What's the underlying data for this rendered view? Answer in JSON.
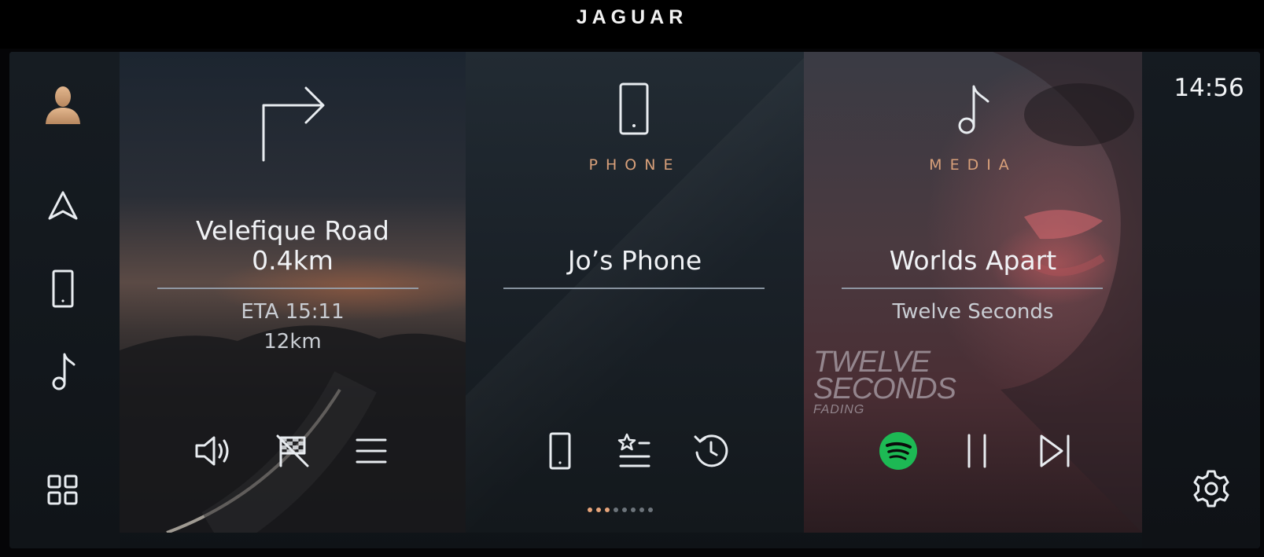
{
  "brand": "JAGUAR",
  "clock": "14:56",
  "sidebar": {
    "items": [
      {
        "icon": "profile-icon"
      },
      {
        "icon": "navigation-arrow-icon"
      },
      {
        "icon": "phone-icon"
      },
      {
        "icon": "music-note-icon"
      },
      {
        "icon": "apps-grid-icon"
      }
    ]
  },
  "navigation": {
    "icon": "turn-right-arrow-icon",
    "street": "Velefique Road",
    "distance_to_turn": "0.4km",
    "eta": "ETA 15:11",
    "remaining_distance": "12km",
    "controls": [
      "volume-icon",
      "end-route-flag-icon",
      "menu-icon"
    ]
  },
  "phone": {
    "icon": "phone-icon",
    "label": "PHONE",
    "device_name": "Jo’s Phone",
    "controls": [
      "phone-icon",
      "favourites-list-icon",
      "recent-calls-icon"
    ]
  },
  "media": {
    "icon": "music-note-icon",
    "label": "MEDIA",
    "track": "Worlds Apart",
    "artist": "Twelve Seconds",
    "album_art_text_line1": "TWELVE",
    "album_art_text_line2": "SECONDS",
    "album_art_text_line3": "FADING",
    "source_icon": "spotify-icon",
    "controls": [
      "pause-icon",
      "skip-next-icon"
    ]
  },
  "pager": {
    "total": 8,
    "active": 3
  },
  "colors": {
    "accent_label": "#d8a07a",
    "spotify_green": "#1db954",
    "divider": "#9aa6b3"
  },
  "settings_icon": "gear-icon"
}
